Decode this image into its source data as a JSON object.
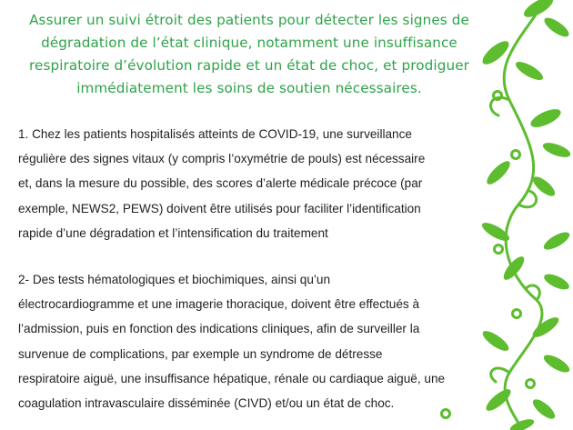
{
  "title_lines": [
    "Assurer un suivi étroit des patients pour détecter les signes de",
    "dégradation de l’état clinique, notamment une insuffisance",
    "respiratoire d’évolution rapide et un état de choc, et prodiguer",
    "immédiatement les soins de soutien nécessaires."
  ],
  "paragraph1_lines": [
    "1. Chez les patients hospitalisés atteints de COVID-19, une surveillance",
    "régulière des signes vitaux (y compris l’oxymétrie de pouls) est nécessaire",
    "et, dans la mesure du possible, des scores d’alerte médicale précoce (par",
    "exemple, NEWS2, PEWS) doivent être utilisés pour faciliter l’identification",
    "rapide d’une dégradation et l’intensification du traitement"
  ],
  "paragraph2_lines": [
    "2- Des tests hématologiques et biochimiques, ainsi qu’un",
    "électrocardiogramme et une imagerie thoracique, doivent être effectués à",
    "l’admission, puis en fonction des indications cliniques, afin de surveiller la",
    "survenue de complications, par exemple un syndrome de détresse",
    "respiratoire aiguë, une insuffisance hépatique, rénale ou cardiaque aiguë, une",
    "coagulation intravasculaire disséminée (CIVD) et/ou un état de choc."
  ],
  "colors": {
    "title": "#2fa349",
    "body_text": "#222222",
    "leaf": "#5dbd2f",
    "background": "#ffffff"
  }
}
